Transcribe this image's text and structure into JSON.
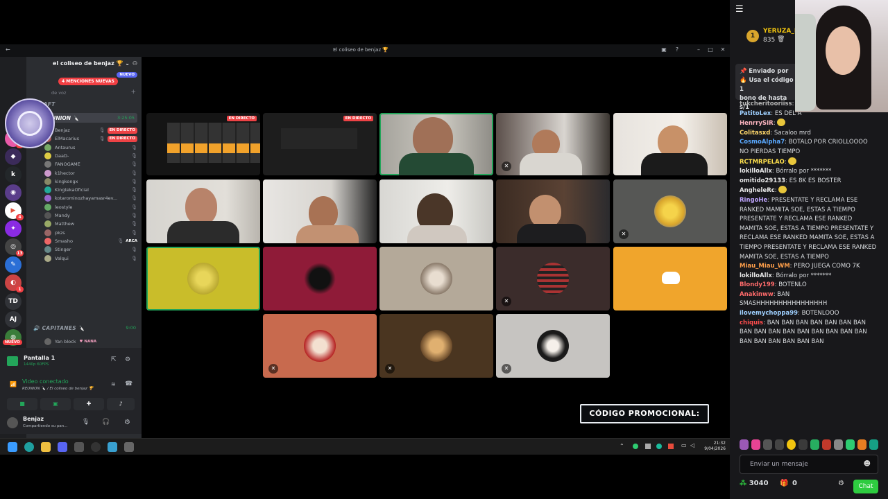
{
  "discord": {
    "window_title": "El coliseo de benjaz 🏆",
    "server_name": "el coliseo de benjaz 🏆",
    "mention_pill": "4 MENCIONES NUEVAS",
    "new_pill": "NUEVO",
    "voice_label": "de voz",
    "nuevo_badge": "NUEVO",
    "categories": {
      "draft": "DRAFT",
      "capitanes": "CAPITANES 🔪",
      "capitanes_time": "9:00"
    },
    "voice_channel": {
      "name": "REUNION 🔪",
      "time": "3:25:05"
    },
    "members": [
      {
        "name": "Benjaz",
        "live": "EN DIRECTO"
      },
      {
        "name": "ElMacarius",
        "live": "EN DIRECTO"
      },
      {
        "name": "Antaurus",
        "live": ""
      },
      {
        "name": "DaaD-",
        "live": ""
      },
      {
        "name": "FANOGAME",
        "live": ""
      },
      {
        "name": "k1hector",
        "live": ""
      },
      {
        "name": "kingkongx",
        "live": ""
      },
      {
        "name": "KingtekaOficial",
        "live": ""
      },
      {
        "name": "kotarominozhayamasr4ev...",
        "live": ""
      },
      {
        "name": "leostyle",
        "live": ""
      },
      {
        "name": "Mandy",
        "live": ""
      },
      {
        "name": "Matthew",
        "live": ""
      },
      {
        "name": "pkzs",
        "live": ""
      },
      {
        "name": "Smasho",
        "live": "ARCA"
      },
      {
        "name": "Stinger",
        "live": ""
      },
      {
        "name": "Valqui",
        "live": ""
      }
    ],
    "capitanes_member": {
      "name": "Yan block",
      "tag": "NANA"
    },
    "screen_share": {
      "title": "Pantalla 1",
      "sub": "1440p 60FPS"
    },
    "video_status": {
      "title": "Video conectado",
      "sub": "REUNION 🔪 / El coliseo de benjaz 🏆"
    },
    "user": {
      "name": "Benjaz",
      "status": "Compartiendo su pan..."
    },
    "live_tag": "EN DIRECTO",
    "server_badges": [
      "TD",
      "AJ"
    ],
    "promo": "CÓDIGO PROMOCIONAL:",
    "clock": {
      "time": "21:32",
      "date": "9/04/2026"
    }
  },
  "chat": {
    "top_user": "YERUZA_M",
    "top_points": "835",
    "rank": "1",
    "sponsor": {
      "label": "Enviado por",
      "text": "Usa el código 1",
      "text2": "bono de hasta s/1"
    },
    "messages": [
      {
        "user": "tukcheritooriiss",
        "color": "#b4b4b4",
        "text": ""
      },
      {
        "user": "PatitoLex",
        "color": "#9fd0ff",
        "text": "ES DEL A"
      },
      {
        "user": "HenrrySIR",
        "color": "#ffb6c1",
        "text": ""
      },
      {
        "user": "Colitasxd",
        "color": "#ffd86b",
        "text": "Sacaloo mrd"
      },
      {
        "user": "CosmoAlpha7",
        "color": "#5aa9ff",
        "text": "BOTALO POR CRIOLLOOOO NO PIERDAS TIEMPO"
      },
      {
        "user": "RCTMRPELAO",
        "color": "#ffe14d",
        "text": ""
      },
      {
        "user": "lokilloAllx",
        "color": "#e8e8e8",
        "text": "Bórralo por *******"
      },
      {
        "user": "omitido29133",
        "color": "#e8e8e8",
        "text": "ES 8K ES BOSTER"
      },
      {
        "user": "AngheleRc",
        "color": "#e8e8e8",
        "text": ""
      },
      {
        "user": "RingoHe",
        "color": "#bfa6ff",
        "text": "PRESENTATE Y RECLAMA ESE RANKED MAMITA SOE, ESTAS A TIEMPO PRESENTATE Y RECLAMA ESE RANKED MAMITA SOE, ESTAS A TIEMPO PRESENTATE Y RECLAMA ESE RANKED MAMITA SOE, ESTAS A TIEMPO PRESENTATE Y RECLAMA ESE RANKED MAMITA SOE, ESTAS A TIEMPO"
      },
      {
        "user": "Miau_Miau_WM",
        "color": "#ff9f4a",
        "text": "PERO JUEGA COMO 7K"
      },
      {
        "user": "lokilloAllx",
        "color": "#e8e8e8",
        "text": "Bórralo por *******"
      },
      {
        "user": "Blondy199",
        "color": "#ff6b6b",
        "text": "BOTENLO"
      },
      {
        "user": "Anakinww",
        "color": "#ff6b6b",
        "text": "BAN SMASHHHHHHHHHHHHHHHH"
      },
      {
        "user": "ilovemychoppa99",
        "color": "#9fd0ff",
        "text": "BOTENLOOO"
      },
      {
        "user": "chiquis",
        "color": "#ff4d4d",
        "text": "BAN BAN BAN BAN BAN BAN BAN BAN BAN BAN BAN BAN BAN BAN BAN BAN BAN BAN BAN BAN BAN BAN"
      }
    ],
    "input_placeholder": "Enviar un mensaje",
    "points": "3040",
    "gifts": "0",
    "send_label": "Chat"
  }
}
